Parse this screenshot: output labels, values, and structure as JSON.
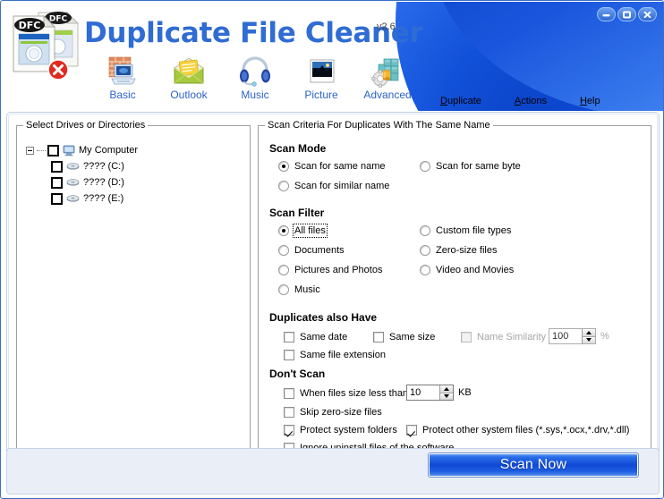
{
  "window": {
    "controls": [
      {
        "name": "minimize",
        "glyph": "minimize-icon"
      },
      {
        "name": "maximize",
        "glyph": "maximize-icon"
      },
      {
        "name": "close",
        "glyph": "close-icon"
      }
    ]
  },
  "header": {
    "logo_icon": "duplicate-file-cleaner-logo",
    "logo_badge": "DFC",
    "title": "Duplicate File Cleaner",
    "version": "v2.6",
    "title_color": "#2f6cd4"
  },
  "toolbar": {
    "items": [
      {
        "label": "Basic",
        "icon": "firewall-computer-icon"
      },
      {
        "label": "Outlook",
        "icon": "envelope-mail-icon"
      },
      {
        "label": "Music",
        "icon": "headphones-icon"
      },
      {
        "label": "Picture",
        "icon": "photo-frame-icon"
      },
      {
        "label": "Advanced",
        "icon": "blocks-gear-icon"
      }
    ]
  },
  "menubar": {
    "items": [
      {
        "accel": "D",
        "rest": "uplicate"
      },
      {
        "accel": "A",
        "rest": "ctions"
      },
      {
        "accel": "H",
        "rest": "elp"
      }
    ]
  },
  "drives_panel": {
    "title": "Select Drives or Directories",
    "root": {
      "label": "My Computer",
      "icon": "my-computer-icon",
      "checked": false,
      "expanded": true
    },
    "drives": [
      {
        "label": "???? (C:)",
        "icon": "drive-icon",
        "checked": false
      },
      {
        "label": "???? (D:)",
        "icon": "drive-icon",
        "checked": false
      },
      {
        "label": "???? (E:)",
        "icon": "drive-icon",
        "checked": false
      }
    ]
  },
  "criteria_panel": {
    "title": "Scan Criteria For Duplicates With The Same Name",
    "scan_mode": {
      "heading": "Scan Mode",
      "options": [
        {
          "label": "Scan for same name",
          "selected": true,
          "col": 0,
          "row": 0
        },
        {
          "label": "Scan for same byte",
          "selected": false,
          "col": 1,
          "row": 0
        },
        {
          "label": "Scan for similar name",
          "selected": false,
          "col": 0,
          "row": 1
        }
      ]
    },
    "scan_filter": {
      "heading": "Scan Filter",
      "options": [
        {
          "label": "All files",
          "selected": true,
          "focused": true,
          "col": 0,
          "row": 0
        },
        {
          "label": "Custom file types",
          "selected": false,
          "focused": false,
          "col": 1,
          "row": 0
        },
        {
          "label": "Documents",
          "selected": false,
          "focused": false,
          "col": 0,
          "row": 1
        },
        {
          "label": "Zero-size files",
          "selected": false,
          "focused": false,
          "col": 1,
          "row": 1
        },
        {
          "label": "Pictures and Photos",
          "selected": false,
          "focused": false,
          "col": 0,
          "row": 2
        },
        {
          "label": "Video and Movies",
          "selected": false,
          "focused": false,
          "col": 1,
          "row": 2
        },
        {
          "label": "Music",
          "selected": false,
          "focused": false,
          "col": 0,
          "row": 3
        }
      ]
    },
    "duplicates_also_have": {
      "heading": "Duplicates also Have",
      "same_date": {
        "label": "Same date",
        "checked": false
      },
      "same_size": {
        "label": "Same size",
        "checked": false
      },
      "same_extension": {
        "label": "Same file extension",
        "checked": false
      },
      "name_similarity": {
        "label": "Name Similarity",
        "checked": false,
        "disabled": true,
        "value": "100",
        "unit": "%"
      }
    },
    "dont_scan": {
      "heading": "Don't Scan",
      "min_size": {
        "label": "When files size less than",
        "checked": false,
        "value": "10",
        "unit": "KB"
      },
      "skip_zero": {
        "label": "Skip zero-size files",
        "checked": false
      },
      "protect_folders": {
        "label": "Protect system folders",
        "checked": true
      },
      "protect_files": {
        "label": "Protect other system files (*.sys,*.ocx,*.drv,*.dll)",
        "checked": true
      },
      "ignore_uninstall": {
        "label": "Ignore uninstall files of the software",
        "checked": true
      }
    }
  },
  "footer": {
    "scan_button": "Scan Now",
    "scan_button_color": "#0f49d6"
  }
}
